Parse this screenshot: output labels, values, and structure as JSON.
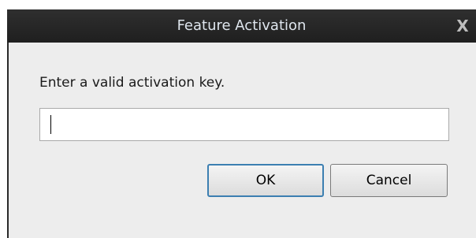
{
  "window": {
    "title": "Feature Activation",
    "close_glyph": "X"
  },
  "form": {
    "prompt": "Enter a valid activation key.",
    "key_value": "",
    "key_placeholder": ""
  },
  "buttons": {
    "ok_label": "OK",
    "cancel_label": "Cancel"
  },
  "colors": {
    "titlebar": "#262626",
    "dialog_bg": "#ededed",
    "ok_focus_border": "#3c7fb1"
  }
}
